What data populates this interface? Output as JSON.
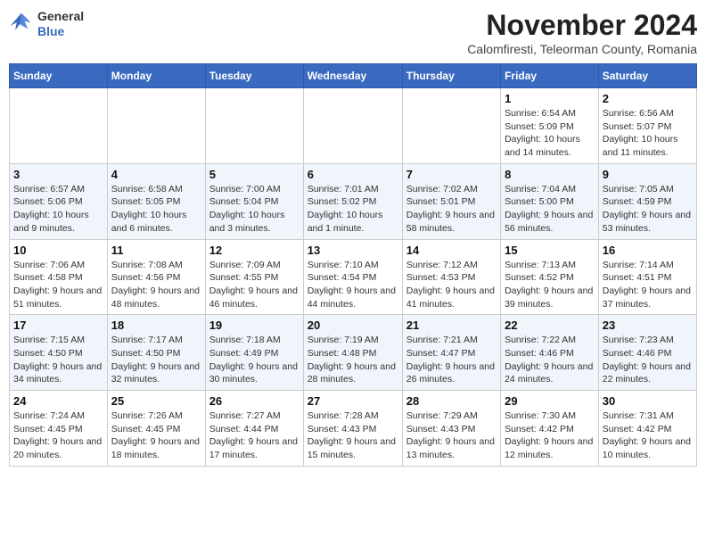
{
  "header": {
    "logo": {
      "general": "General",
      "blue": "Blue"
    },
    "title": "November 2024",
    "subtitle": "Calomfiresti, Teleorman County, Romania"
  },
  "days_of_week": [
    "Sunday",
    "Monday",
    "Tuesday",
    "Wednesday",
    "Thursday",
    "Friday",
    "Saturday"
  ],
  "weeks": [
    [
      {
        "day": "",
        "info": ""
      },
      {
        "day": "",
        "info": ""
      },
      {
        "day": "",
        "info": ""
      },
      {
        "day": "",
        "info": ""
      },
      {
        "day": "",
        "info": ""
      },
      {
        "day": "1",
        "info": "Sunrise: 6:54 AM\nSunset: 5:09 PM\nDaylight: 10 hours and 14 minutes."
      },
      {
        "day": "2",
        "info": "Sunrise: 6:56 AM\nSunset: 5:07 PM\nDaylight: 10 hours and 11 minutes."
      }
    ],
    [
      {
        "day": "3",
        "info": "Sunrise: 6:57 AM\nSunset: 5:06 PM\nDaylight: 10 hours and 9 minutes."
      },
      {
        "day": "4",
        "info": "Sunrise: 6:58 AM\nSunset: 5:05 PM\nDaylight: 10 hours and 6 minutes."
      },
      {
        "day": "5",
        "info": "Sunrise: 7:00 AM\nSunset: 5:04 PM\nDaylight: 10 hours and 3 minutes."
      },
      {
        "day": "6",
        "info": "Sunrise: 7:01 AM\nSunset: 5:02 PM\nDaylight: 10 hours and 1 minute."
      },
      {
        "day": "7",
        "info": "Sunrise: 7:02 AM\nSunset: 5:01 PM\nDaylight: 9 hours and 58 minutes."
      },
      {
        "day": "8",
        "info": "Sunrise: 7:04 AM\nSunset: 5:00 PM\nDaylight: 9 hours and 56 minutes."
      },
      {
        "day": "9",
        "info": "Sunrise: 7:05 AM\nSunset: 4:59 PM\nDaylight: 9 hours and 53 minutes."
      }
    ],
    [
      {
        "day": "10",
        "info": "Sunrise: 7:06 AM\nSunset: 4:58 PM\nDaylight: 9 hours and 51 minutes."
      },
      {
        "day": "11",
        "info": "Sunrise: 7:08 AM\nSunset: 4:56 PM\nDaylight: 9 hours and 48 minutes."
      },
      {
        "day": "12",
        "info": "Sunrise: 7:09 AM\nSunset: 4:55 PM\nDaylight: 9 hours and 46 minutes."
      },
      {
        "day": "13",
        "info": "Sunrise: 7:10 AM\nSunset: 4:54 PM\nDaylight: 9 hours and 44 minutes."
      },
      {
        "day": "14",
        "info": "Sunrise: 7:12 AM\nSunset: 4:53 PM\nDaylight: 9 hours and 41 minutes."
      },
      {
        "day": "15",
        "info": "Sunrise: 7:13 AM\nSunset: 4:52 PM\nDaylight: 9 hours and 39 minutes."
      },
      {
        "day": "16",
        "info": "Sunrise: 7:14 AM\nSunset: 4:51 PM\nDaylight: 9 hours and 37 minutes."
      }
    ],
    [
      {
        "day": "17",
        "info": "Sunrise: 7:15 AM\nSunset: 4:50 PM\nDaylight: 9 hours and 34 minutes."
      },
      {
        "day": "18",
        "info": "Sunrise: 7:17 AM\nSunset: 4:50 PM\nDaylight: 9 hours and 32 minutes."
      },
      {
        "day": "19",
        "info": "Sunrise: 7:18 AM\nSunset: 4:49 PM\nDaylight: 9 hours and 30 minutes."
      },
      {
        "day": "20",
        "info": "Sunrise: 7:19 AM\nSunset: 4:48 PM\nDaylight: 9 hours and 28 minutes."
      },
      {
        "day": "21",
        "info": "Sunrise: 7:21 AM\nSunset: 4:47 PM\nDaylight: 9 hours and 26 minutes."
      },
      {
        "day": "22",
        "info": "Sunrise: 7:22 AM\nSunset: 4:46 PM\nDaylight: 9 hours and 24 minutes."
      },
      {
        "day": "23",
        "info": "Sunrise: 7:23 AM\nSunset: 4:46 PM\nDaylight: 9 hours and 22 minutes."
      }
    ],
    [
      {
        "day": "24",
        "info": "Sunrise: 7:24 AM\nSunset: 4:45 PM\nDaylight: 9 hours and 20 minutes."
      },
      {
        "day": "25",
        "info": "Sunrise: 7:26 AM\nSunset: 4:45 PM\nDaylight: 9 hours and 18 minutes."
      },
      {
        "day": "26",
        "info": "Sunrise: 7:27 AM\nSunset: 4:44 PM\nDaylight: 9 hours and 17 minutes."
      },
      {
        "day": "27",
        "info": "Sunrise: 7:28 AM\nSunset: 4:43 PM\nDaylight: 9 hours and 15 minutes."
      },
      {
        "day": "28",
        "info": "Sunrise: 7:29 AM\nSunset: 4:43 PM\nDaylight: 9 hours and 13 minutes."
      },
      {
        "day": "29",
        "info": "Sunrise: 7:30 AM\nSunset: 4:42 PM\nDaylight: 9 hours and 12 minutes."
      },
      {
        "day": "30",
        "info": "Sunrise: 7:31 AM\nSunset: 4:42 PM\nDaylight: 9 hours and 10 minutes."
      }
    ]
  ]
}
